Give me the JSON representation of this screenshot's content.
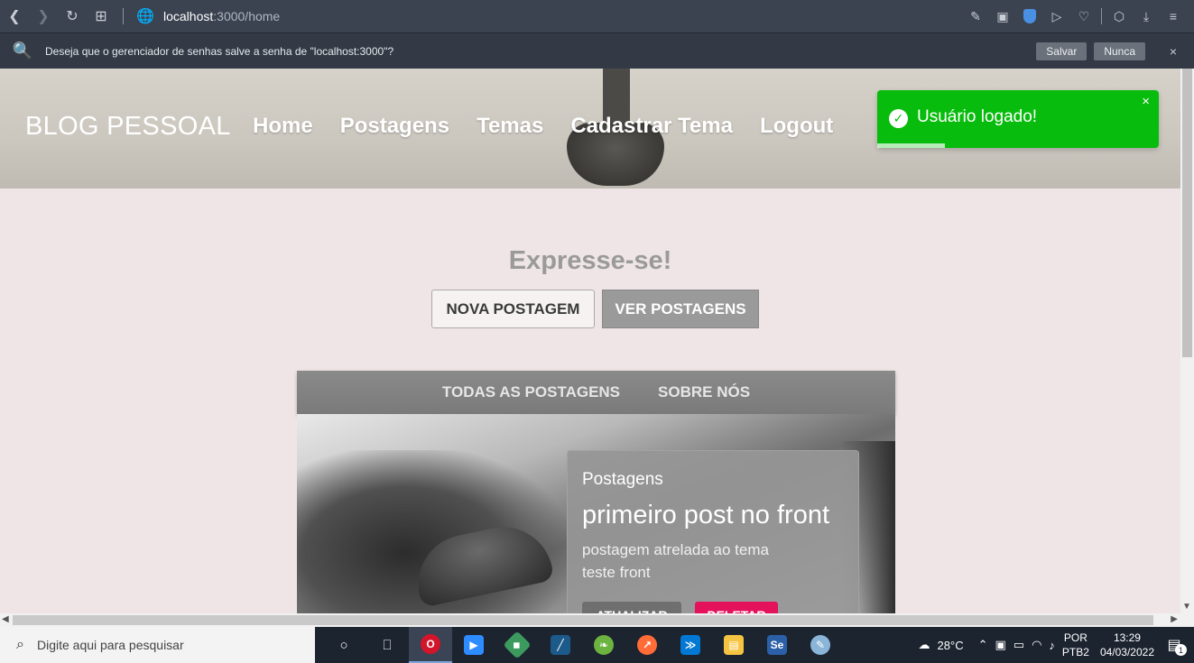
{
  "browser": {
    "url_host": "localhost",
    "url_path": ":3000/home",
    "icons": [
      "back-icon",
      "forward-icon",
      "reload-icon",
      "tabs-grid-icon",
      "globe-icon"
    ]
  },
  "password_bar": {
    "message": "Deseja que o gerenciador de senhas salve a senha de \"localhost:3000\"?",
    "save_label": "Salvar",
    "never_label": "Nunca",
    "close_label": "×"
  },
  "site": {
    "brand": "BLOG PESSOAL",
    "nav": [
      "Home",
      "Postagens",
      "Temas",
      "Cadastrar Tema",
      "Logout"
    ],
    "welcome": "Expresse-se!",
    "new_post_label": "NOVA POSTAGEM",
    "view_posts_label": "VER POSTAGENS",
    "tabs": [
      "TODAS AS POSTAGENS",
      "SOBRE NÓS"
    ]
  },
  "toast": {
    "message": "Usuário logado!",
    "close": "×",
    "color": "#07bc0c",
    "progress": 0.24
  },
  "post": {
    "category": "Postagens",
    "title": "primeiro post no front",
    "description": "postagem atrelada ao tema teste front",
    "update_label": "ATUALIZAR",
    "delete_label": "DELETAR",
    "delete_color": "#e3125b"
  },
  "taskbar": {
    "search_placeholder": "Digite aqui para pesquisar",
    "weather": "28°C",
    "lang_top": "POR",
    "lang_bottom": "PTB2",
    "time": "13:29",
    "date": "04/03/2022",
    "notifications": "1"
  }
}
